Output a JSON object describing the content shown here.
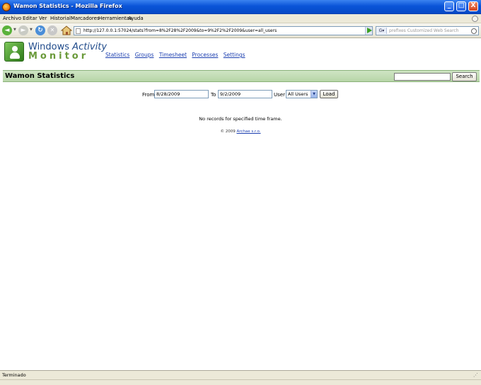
{
  "window": {
    "title": "Wamon Statistics - Mozilla Firefox",
    "controls": {
      "minimize": "_",
      "maximize": "□",
      "close": "X"
    }
  },
  "menu": [
    "Archivo",
    "Editar",
    "Ver",
    "Historial",
    "Marcadores",
    "Herramientas",
    "Ayuda"
  ],
  "toolbar": {
    "url": "http://127.0.0.1:57024/stats?from=8%2F28%2F2009&to=9%2F2%2F2009&user=all_users",
    "search_placeholder": "prefixes Customized Web Search"
  },
  "brand": {
    "line1_a": "Windows ",
    "line1_b": "Activity",
    "line2": "Monitor"
  },
  "nav": [
    "Statistics",
    "Groups",
    "Timesheet",
    "Processes",
    "Settings"
  ],
  "header": {
    "title": "Wamon Statistics",
    "search_button": "Search"
  },
  "filter": {
    "from_label": "From",
    "from_value": "8/28/2009",
    "to_label": "To",
    "to_value": "9/2/2009",
    "user_label": "User",
    "user_selected": "All Users",
    "load_button": "Load"
  },
  "message": "No records for specified time frame.",
  "footer": {
    "copyright": "© 2009 ",
    "company": "Archae s.r.o."
  },
  "status": "Terminado",
  "colors": {
    "titlebar": "#0a54d8",
    "header_green": "#b7d6a7",
    "link": "#1c3fb0"
  }
}
